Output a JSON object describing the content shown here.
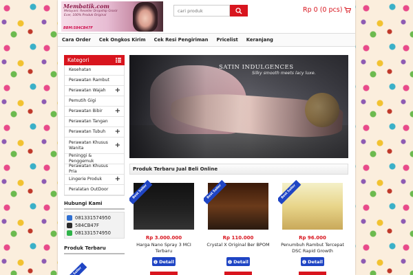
{
  "header": {
    "logo_title": "Membatik.com",
    "logo_sub": "Melayani: Reseller Dropship Grosir Ecer, 100% Produk Original",
    "logo_bbm": "BBM:584CB47F",
    "search_placeholder": "cari produk",
    "cart_label": "Rp 0 (0 pcs)"
  },
  "nav": {
    "items": [
      "Cara Order",
      "Cek Ongkos Kirim",
      "Cek Resi Pengiriman",
      "Pricelist",
      "Keranjang"
    ]
  },
  "sidebar": {
    "category_title": "Kategori",
    "categories": [
      {
        "label": "Kesehatan",
        "expandable": false
      },
      {
        "label": "Perawatan Rambut",
        "expandable": false
      },
      {
        "label": "Perawatan Wajah",
        "expandable": true
      },
      {
        "label": "Pemutih Gigi",
        "expandable": false
      },
      {
        "label": "Perawatan Bibir",
        "expandable": true
      },
      {
        "label": "Perawatan Tangan",
        "expandable": false
      },
      {
        "label": "Perawatan Tubuh",
        "expandable": true
      },
      {
        "label": "Perawatan Khusus Wanita",
        "expandable": true
      },
      {
        "label": "Peninggi & Penggemuk",
        "expandable": false
      },
      {
        "label": "Perawatan Khusus Pria",
        "expandable": false
      },
      {
        "label": "Lingerie Produk",
        "expandable": true
      },
      {
        "label": "Peralatan OutDoor",
        "expandable": false
      }
    ],
    "contact_title": "Hubungi Kami",
    "contacts": [
      {
        "icon": "phone-icon",
        "value": "081331574950",
        "color": "#2f6fd1"
      },
      {
        "icon": "bbm-icon",
        "value": "584CB47F",
        "color": "#2b2b2b"
      },
      {
        "icon": "whatsapp-icon",
        "value": "081331574950",
        "color": "#2fb34a"
      }
    ],
    "latest_title": "Produk Terbaru",
    "ribbon": "Best Seller"
  },
  "banner": {
    "title": "SATIN INDULGENCES",
    "subtitle": "Silky smooth meets lacy luxe."
  },
  "main": {
    "latest_heading": "Produk Terbaru Jual Beli Online",
    "products": [
      {
        "price": "Rp 3.000.000",
        "name": "Harga Nano Spray 3 MCI Terbaru",
        "button": "Detail",
        "ribbon": "Best Seller"
      },
      {
        "price": "Rp 110.000",
        "name": "Crystal X Original Ber BPOM",
        "button": "Detail",
        "ribbon": "Best Seller"
      },
      {
        "price": "Rp 96.000",
        "name": "Penumbuh Rambut Tercepat DSC Rapid Growth",
        "button": "Detail",
        "ribbon": "Best Seller"
      }
    ]
  },
  "colors": {
    "accent_red": "#d8151e",
    "button_blue": "#1f45c4"
  }
}
